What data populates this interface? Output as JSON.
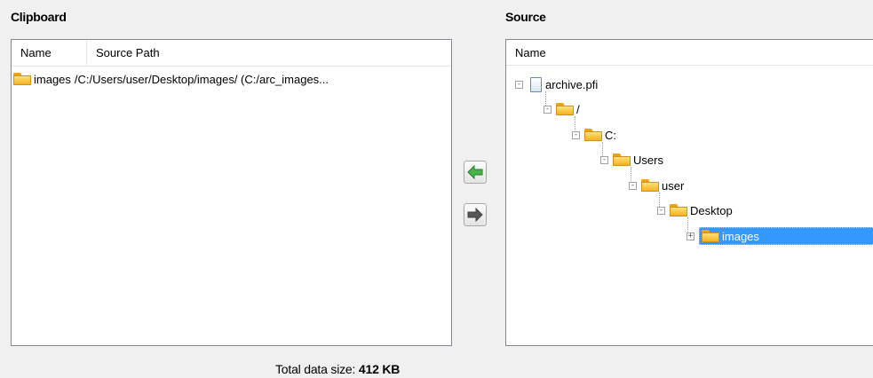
{
  "clipboard": {
    "title": "Clipboard",
    "columns": [
      "Name",
      "Source Path"
    ],
    "rows": [
      {
        "name": "images",
        "path": "/C:/Users/user/Desktop/images/ (C:/arc_images..."
      }
    ]
  },
  "source": {
    "title": "Source",
    "column": "Name",
    "tree": {
      "n0": "archive.pfi",
      "n1": "/",
      "n2": "C:",
      "n3": "Users",
      "n4": "user",
      "n5": "Desktop",
      "n6": "images"
    },
    "selected": "images"
  },
  "buttons": {
    "add_icon": "green-left-arrow-icon",
    "remove_icon": "gray-right-arrow-icon"
  },
  "footer": {
    "total_label": "Total data size:",
    "total_value": "412 KB"
  },
  "colors": {
    "selection": "#3399ff",
    "folder": "#f5b21f",
    "add_arrow": "#3aa43a"
  }
}
